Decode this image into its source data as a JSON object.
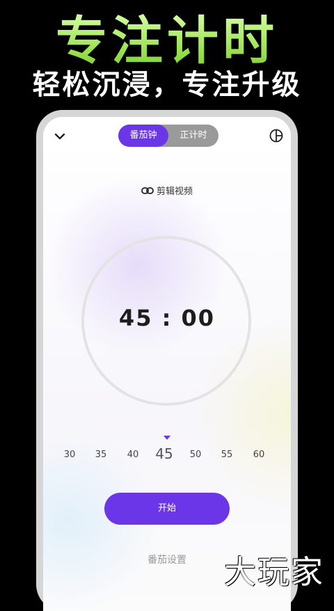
{
  "promo": {
    "headline": "专注计时",
    "subline": "轻松沉浸，专注升级"
  },
  "app": {
    "tabs": [
      {
        "label": "番茄钟",
        "active": true
      },
      {
        "label": "正计时",
        "active": false
      }
    ],
    "back_icon": "chevron-down-icon",
    "stats_icon": "pie-chart-icon",
    "clip_link": {
      "icon": "link-icon",
      "label": "剪辑视频"
    },
    "timer": {
      "display": "45 : 00"
    },
    "duration_picker": {
      "options": [
        "30",
        "35",
        "40",
        "45",
        "50",
        "55",
        "60"
      ],
      "selected": "45"
    },
    "start_label": "开始",
    "settings_label": "番茄设置"
  },
  "watermark": "大玩家",
  "colors": {
    "accent": "#6b36e8",
    "headline_green": "#95e04a",
    "segment_inactive": "#9a9a9a"
  }
}
